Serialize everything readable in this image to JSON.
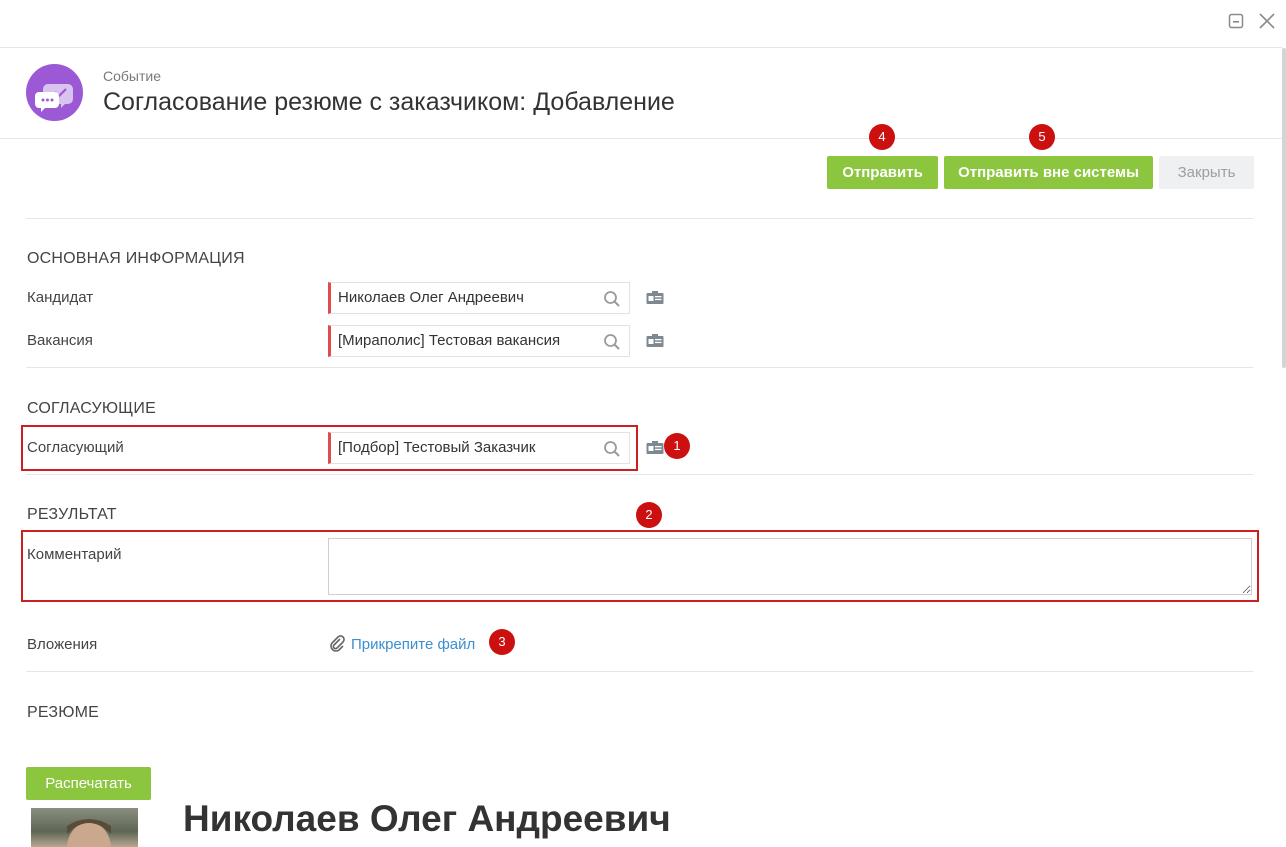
{
  "header": {
    "subtitle": "Событие",
    "title": "Согласование резюме с заказчиком: Добавление"
  },
  "toolbar": {
    "send_label": "Отправить",
    "send_outside_label": "Отправить вне системы",
    "close_label": "Закрыть"
  },
  "badges": [
    "1",
    "2",
    "3",
    "4",
    "5"
  ],
  "sections": {
    "main_info": "ОСНОВНАЯ ИНФОРМАЦИЯ",
    "approvers": "СОГЛАСУЮЩИЕ",
    "result": "РЕЗУЛЬТАТ",
    "resume": "РЕЗЮМЕ"
  },
  "fields": {
    "candidate": {
      "label": "Кандидат",
      "value": "Николаев Олег Андреевич"
    },
    "vacancy": {
      "label": "Вакансия",
      "value": "[Мираполис] Тестовая вакансия"
    },
    "approver": {
      "label": "Согласующий",
      "value": "[Подбор] Тестовый Заказчик"
    },
    "comment": {
      "label": "Комментарий",
      "value": ""
    },
    "attachments": {
      "label": "Вложения",
      "link": "Прикрепите файл"
    }
  },
  "resume": {
    "print_label": "Распечатать",
    "person_name": "Николаев Олег Андреевич"
  },
  "colors": {
    "green": "#8cc63f",
    "badge_red": "#cc0f0f",
    "required_marker": "#e04b4b",
    "link_blue": "#3a8fd1",
    "avatar_purple": "#9b59d6"
  },
  "icons": {
    "window": [
      "minimize-icon",
      "close-icon"
    ],
    "avatar": "chat-check-icon",
    "field_actions": [
      "search-icon",
      "card-icon"
    ],
    "attachment": "paperclip-icon"
  }
}
